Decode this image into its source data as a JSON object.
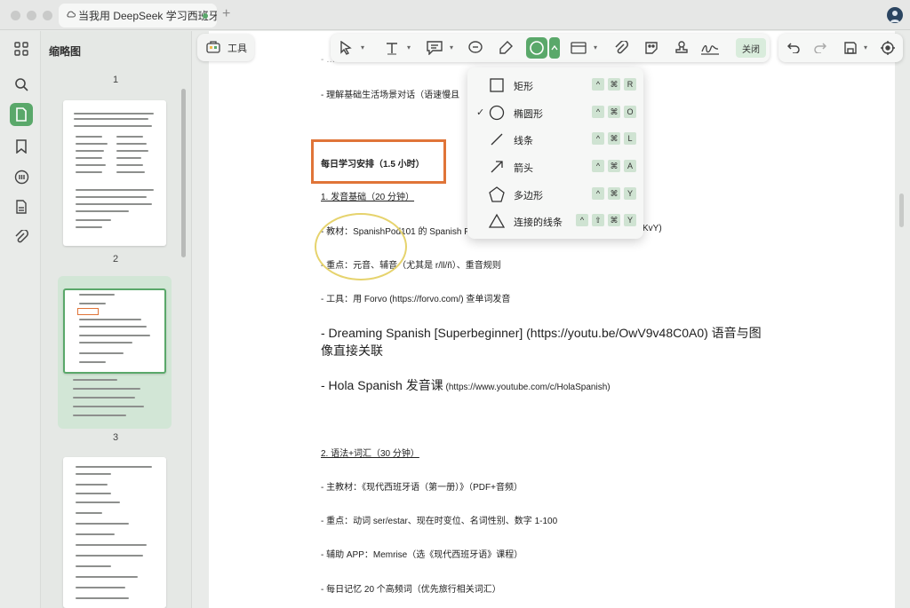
{
  "tab": {
    "title": "当我用 DeepSeek 学习西班牙语"
  },
  "sidebar": {
    "thumbnails_title": "缩略图",
    "page_numbers": [
      "1",
      "2",
      "3"
    ]
  },
  "tools_button": {
    "label": "工具"
  },
  "toolbar": {
    "close_label": "关闭"
  },
  "shape_menu": {
    "items": [
      {
        "label": "矩形",
        "icon": "rectangle-icon",
        "checked": false,
        "keys": [
          "^",
          "⌘",
          "R"
        ]
      },
      {
        "label": "椭圆形",
        "icon": "ellipse-icon",
        "checked": true,
        "keys": [
          "^",
          "⌘",
          "O"
        ]
      },
      {
        "label": "线条",
        "icon": "line-icon",
        "checked": false,
        "keys": [
          "^",
          "⌘",
          "L"
        ]
      },
      {
        "label": "箭头",
        "icon": "arrow-icon",
        "checked": false,
        "keys": [
          "^",
          "⌘",
          "A"
        ]
      },
      {
        "label": "多边形",
        "icon": "polygon-icon",
        "checked": false,
        "keys": [
          "^",
          "⌘",
          "Y"
        ]
      },
      {
        "label": "连接的线条",
        "icon": "connected-lines-icon",
        "checked": false,
        "keys": [
          "^",
          "⇧",
          "⌘",
          "Y"
        ]
      }
    ],
    "check_mark": "✓"
  },
  "document": {
    "line_top": "- 理解基础生活场景对话（语速慢且",
    "daily_heading": "每日学习安排（1.5 小时）",
    "section1": "1. 发音基础（20 分钟）",
    "textbook1": "- 教材：SpanishPod101 的 Spanish Pr",
    "textbook1_tail": "KvY)",
    "focus1": "- 重点：元音、辅音（尤其是 r/ll/ñ）、重音规则",
    "tool1": "- 工具：用 Forvo (https://forvo.com/) 查单词发音",
    "dreaming_1": "- Dreaming Spanish [Superbeginner] (https://youtu.be/OwV9v48C0A0) 语音与图",
    "dreaming_2": "像直接关联",
    "hola": "- Hola Spanish 发音课",
    "hola_link": "(https://www.youtube.com/c/HolaSpanish)",
    "section2": "2. 语法+词汇（30 分钟）",
    "textbook2": "- 主教材：《现代西班牙语（第一册）》（PDF+音频）",
    "focus2": "- 重点：动词 ser/estar、现在时变位、名词性别、数字 1-100",
    "app": "- 辅助 APP：Memrise（选《现代西班牙语》课程）",
    "daily_words": "- 每日记忆 20 个高频词（优先旅行相关词汇）"
  },
  "colors": {
    "accent": "#5aa86a",
    "highlight_box": "#e07438",
    "highlight_ellipse": "#e6d36d"
  }
}
